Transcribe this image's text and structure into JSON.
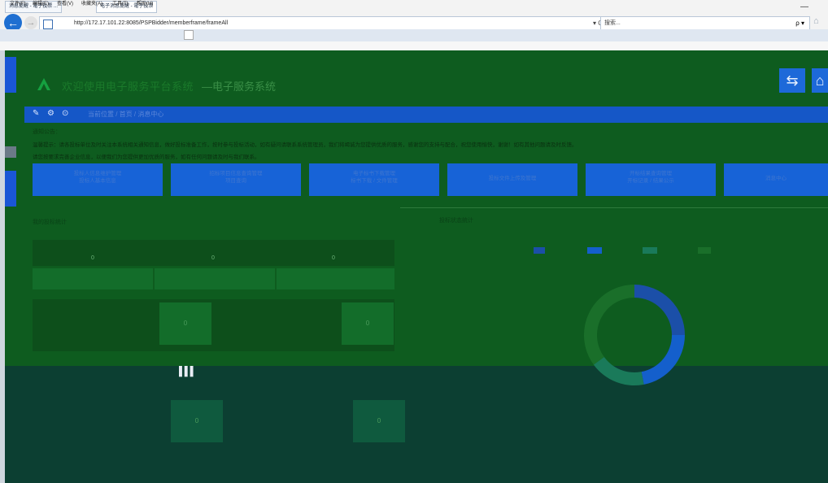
{
  "browser": {
    "url": "http://172.17.101.22:8085/PSPBidder/memberframe/frameAll",
    "refresh_glyph": "▾ C",
    "search_placeholder": "搜索...",
    "search_icon": "ρ ▾",
    "tabs": [
      {
        "label": "消息提醒 - 電子投票 ..."
      },
      {
        "label": "电子消息提醒 - 電子投票"
      }
    ],
    "menu": [
      "文件(F)",
      "编辑(E)",
      "查看(V)",
      "收藏夹(A)",
      "工具(T)",
      "帮助(H)"
    ],
    "icons": [
      "back-icon",
      "forward-icon",
      "page-icon",
      "refresh-icon",
      "search-icon",
      "home-icon",
      "minimize-icon"
    ]
  },
  "header": {
    "system_name": "欢迎使用电子服务平台系统",
    "subtitle": "—电子服务系统",
    "buttons": [
      {
        "glyph": "⇆",
        "icon": "switch-icon"
      },
      {
        "glyph": "⌂",
        "icon": "home-icon"
      }
    ]
  },
  "nav": {
    "icons": [
      "✎",
      "⚙",
      "⊙"
    ],
    "text": "当前位置 / 首页 / 消息中心"
  },
  "notice": {
    "title": "通知公告：",
    "lines": [
      "温馨提示：请各投标单位及时关注本系统相关通知信息，做好投标准备工作，按时参与投标活动，如有疑问请联系系统管理员，我们将竭诚为您提供优质的服务，感谢您的支持与配合，祝您使用愉快，谢谢！如有其他问题请及时反馈。",
      "请您按要求完善企业信息，以便我们为您提供更加优质的服务，如有任何问题请及时与我们联系。"
    ]
  },
  "quick_buttons": [
    {
      "line1": "投标人信息维护管理",
      "line2": "投标人基本信息"
    },
    {
      "line1": "招标项目信息查询管理",
      "line2": "项目查询"
    },
    {
      "line1": "电子标书下载管理",
      "line2": "标书下载 / 文件管理"
    },
    {
      "line1": "投标文件上传及管理",
      "line2": ""
    },
    {
      "line1": "开标结果查询管理",
      "line2": "开标记录 / 结果公示"
    },
    {
      "line1": "消息中心",
      "line2": ""
    }
  ],
  "sections": {
    "left_title": "我的投标统计",
    "right_title": "投标状态统计"
  },
  "stats": {
    "top_values": [
      "0",
      "0",
      "0"
    ],
    "grid_values": [
      "0",
      "0",
      "0",
      "0"
    ]
  },
  "chart_data": {
    "type": "pie",
    "title": "",
    "legend_position": "top",
    "slice_colors": [
      "#1b4fa8",
      "#145fcc",
      "#1a7a5a",
      "#1a6f2a"
    ],
    "values": [
      25,
      22,
      18,
      35
    ]
  },
  "colors": {
    "content_bg": "#0e5c1f",
    "accent_blue": "#1763d7",
    "bottom_bg": "#0c3f32"
  }
}
